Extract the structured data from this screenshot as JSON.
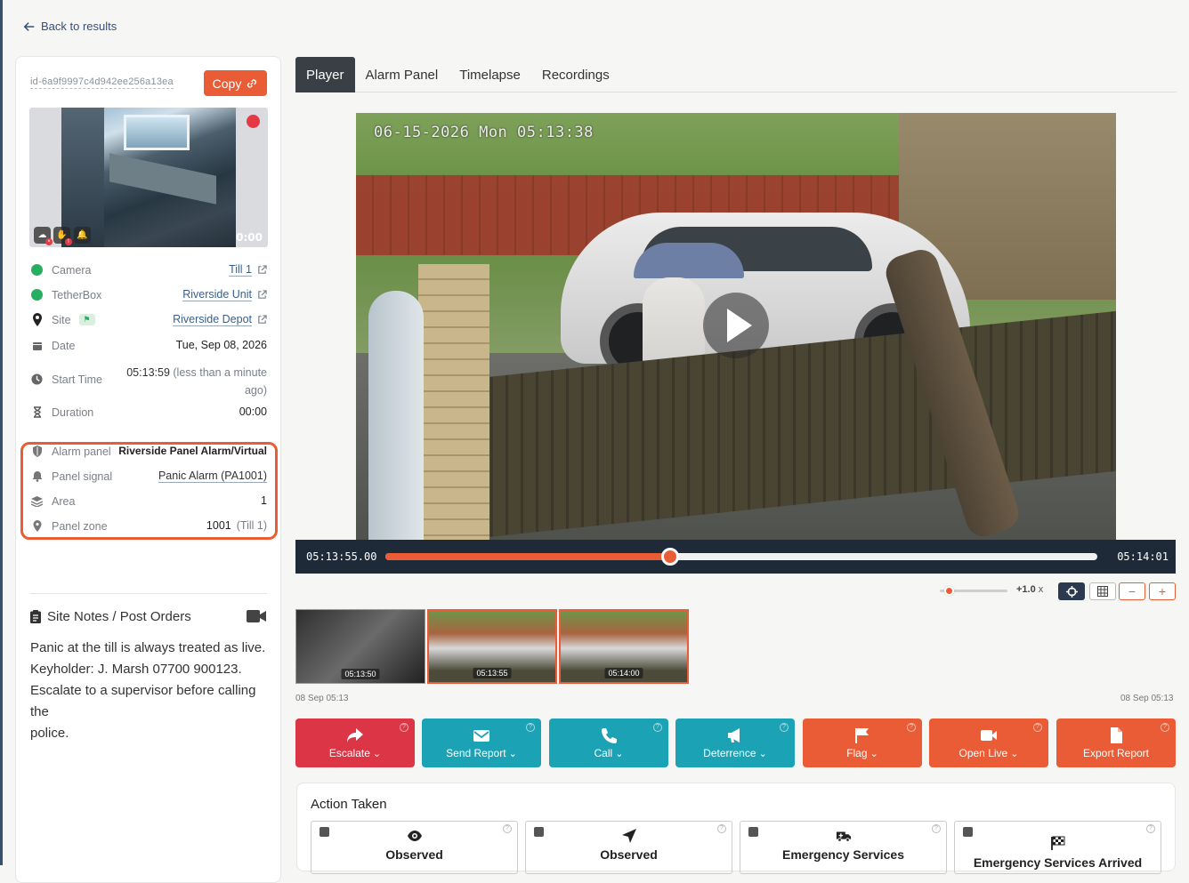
{
  "back": {
    "label": "Back to results"
  },
  "event": {
    "id": "id-6a9f9997c4d942ee256a13ea",
    "copy_label": "Copy"
  },
  "thumbnail": {
    "time": "0:00"
  },
  "details": {
    "camera": {
      "label": "Camera",
      "value": "Till 1"
    },
    "tetherbox": {
      "label": "TetherBox",
      "value": "Riverside Unit"
    },
    "site": {
      "label": "Site",
      "value": "Riverside Depot"
    },
    "date": {
      "label": "Date",
      "value": "Tue,  Sep 08,  2026"
    },
    "start_time": {
      "label": "Start Time",
      "value": "05:13:59",
      "relative": "(less than a minute",
      "relative2": "ago)"
    },
    "duration": {
      "label": "Duration",
      "value": "00:00"
    }
  },
  "alarm": {
    "panel": {
      "label": "Alarm panel",
      "value": "Riverside Panel Alarm/Virtual"
    },
    "signal": {
      "label": "Panel signal",
      "value": "Panic Alarm (PA1001)"
    },
    "area": {
      "label": "Area",
      "value": "1"
    },
    "zone": {
      "label": "Panel zone",
      "value": "1001",
      "extra": "(Till 1)"
    }
  },
  "notes": {
    "title": "Site Notes / Post Orders",
    "lines": [
      "Panic at the till is always treated as live.",
      "Keyholder: J. Marsh 07700 900123.",
      "Escalate to a supervisor before calling the",
      "police."
    ]
  },
  "tabs": [
    "Player",
    "Alarm Panel",
    "Timelapse",
    "Recordings"
  ],
  "video": {
    "overlay_timestamp": "06-15-2026 Mon 05:13:38"
  },
  "player": {
    "current_time": "05:13:55.00",
    "end_time": "05:14:01",
    "progress": 0.4,
    "speed": "+1.0",
    "speed_unit": "x",
    "speed_level": 0.05
  },
  "frames": [
    {
      "time": "05:13:50",
      "selected": false
    },
    {
      "time": "05:13:55",
      "selected": true
    },
    {
      "time": "05:14:00",
      "selected": true
    }
  ],
  "frame_range": {
    "start": "08 Sep 05:13",
    "end": "08 Sep 05:13"
  },
  "actions": [
    {
      "label": "Escalate",
      "color": "#dc3545",
      "icon": "share-icon"
    },
    {
      "label": "Send Report",
      "color": "#1ba2b5",
      "icon": "envelope-icon"
    },
    {
      "label": "Call",
      "color": "#1ba2b5",
      "icon": "phone-icon"
    },
    {
      "label": "Deterrence",
      "color": "#1ba2b5",
      "icon": "megaphone-icon"
    },
    {
      "label": "Flag",
      "color": "#ea5c35",
      "icon": "flag-icon"
    },
    {
      "label": "Open Live",
      "color": "#ea5c35",
      "icon": "video-icon"
    },
    {
      "label": "Export Report",
      "color": "#ea5c35",
      "icon": "pdf-icon"
    }
  ],
  "action_taken": {
    "title": "Action Taken",
    "cards": [
      "Observed",
      "Observed",
      "Emergency Services",
      "Emergency Services Arrived"
    ]
  }
}
